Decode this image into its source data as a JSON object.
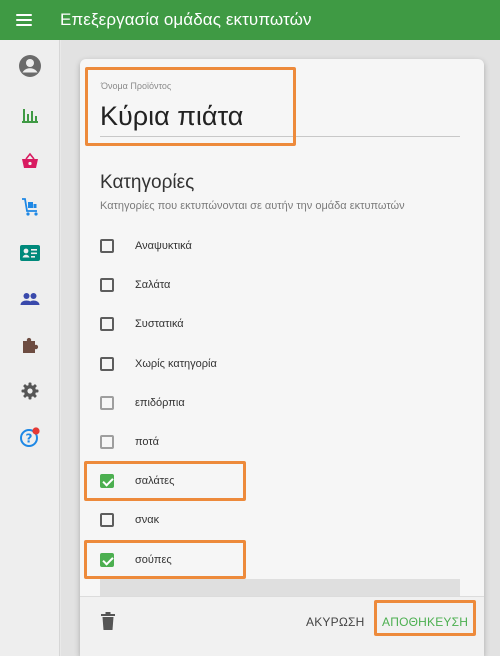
{
  "appbar": {
    "title": "Επεξεργασία ομάδας εκτυπωτών"
  },
  "sidebar": {
    "icons": [
      "account-icon",
      "bar-chart-icon",
      "basket-icon",
      "cart-icon",
      "contact-card-icon",
      "group-icon",
      "puzzle-icon",
      "settings-icon",
      "help-icon"
    ]
  },
  "dialog": {
    "name_field": {
      "label": "Όνομα Προϊόντος",
      "value": "Κύρια πιάτα"
    },
    "categories": {
      "title": "Κατηγορίες",
      "subtitle": "Κατηγορίες που εκτυπώνονται σε αυτήν την ομάδα εκτυπωτών",
      "items": [
        {
          "label": "Αναψυκτικά",
          "checked": false
        },
        {
          "label": "Σαλάτα",
          "checked": false
        },
        {
          "label": "Συστατικά",
          "checked": false
        },
        {
          "label": "Χωρίς κατηγορία",
          "checked": false
        },
        {
          "label": "επιδόρπια",
          "checked": false
        },
        {
          "label": "ποτά",
          "checked": false
        },
        {
          "label": "σαλάτες",
          "checked": true
        },
        {
          "label": "σνακ",
          "checked": false
        },
        {
          "label": "σούπες",
          "checked": true
        }
      ]
    },
    "footer": {
      "cancel_label": "ΑΚΥΡΩΣΗ",
      "save_label": "ΑΠΟΘΗΚΕΥΣΗ"
    }
  },
  "colors": {
    "primary": "#3f9a44",
    "accent": "#4caf50",
    "highlight": "#ed8a3b"
  }
}
